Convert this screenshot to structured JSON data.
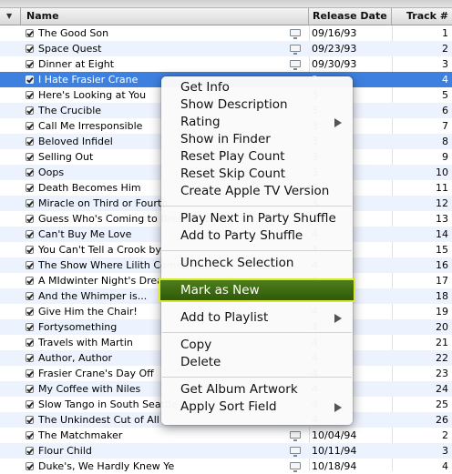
{
  "columns": {
    "name": "Name",
    "release_date": "Release Date",
    "track": "Track #"
  },
  "tracks": [
    {
      "name": "The Good Son",
      "date": "09/16/93",
      "track": "1",
      "tv": true
    },
    {
      "name": "Space Quest",
      "date": "09/23/93",
      "track": "2",
      "tv": true
    },
    {
      "name": "Dinner at Eight",
      "date": "09/30/93",
      "track": "3",
      "tv": true
    },
    {
      "name": "I Hate Frasier Crane",
      "date": "3",
      "track": "4",
      "tv": false
    },
    {
      "name": "Here's Looking at You",
      "date": "3",
      "track": "5",
      "tv": false
    },
    {
      "name": "The Crucible",
      "date": "3",
      "track": "6",
      "tv": false
    },
    {
      "name": "Call Me Irresponsible",
      "date": "3",
      "track": "7",
      "tv": false
    },
    {
      "name": "Beloved Infidel",
      "date": "3",
      "track": "8",
      "tv": false
    },
    {
      "name": "Selling Out",
      "date": "3",
      "track": "9",
      "tv": false
    },
    {
      "name": "Oops",
      "date": "3",
      "track": "10",
      "tv": false
    },
    {
      "name": "Death Becomes Him",
      "date": "3",
      "track": "11",
      "tv": false
    },
    {
      "name": "Miracle on Third or Fourth",
      "date": "3",
      "track": "12",
      "tv": false
    },
    {
      "name": "Guess Who's Coming to Breakfast",
      "date": "4",
      "track": "13",
      "tv": false
    },
    {
      "name": "Can't Buy Me Love",
      "date": "4",
      "track": "14",
      "tv": false
    },
    {
      "name": "You Can't Tell a Crook by",
      "date": "4",
      "track": "15",
      "tv": false
    },
    {
      "name": "The Show Where Lilith Comes",
      "date": "4",
      "track": "16",
      "tv": false
    },
    {
      "name": "A MIdwinter Night's Dream",
      "date": "4",
      "track": "17",
      "tv": false
    },
    {
      "name": "And the Whimper is...",
      "date": "4",
      "track": "18",
      "tv": false
    },
    {
      "name": "Give Him the Chair!",
      "date": "4",
      "track": "19",
      "tv": false
    },
    {
      "name": "Fortysomething",
      "date": "4",
      "track": "20",
      "tv": false
    },
    {
      "name": "Travels with Martin",
      "date": "4",
      "track": "21",
      "tv": false
    },
    {
      "name": "Author, Author",
      "date": "4",
      "track": "22",
      "tv": false
    },
    {
      "name": "Frasier Crane's Day Off",
      "date": "4",
      "track": "23",
      "tv": false
    },
    {
      "name": "My Coffee with Niles",
      "date": "4",
      "track": "24",
      "tv": false
    },
    {
      "name": "Slow Tango in South Seattle",
      "date": "4",
      "track": "25",
      "tv": false
    },
    {
      "name": "The Unkindest Cut of All",
      "date": "4",
      "track": "26",
      "tv": false
    },
    {
      "name": "The Matchmaker",
      "date": "10/04/94",
      "track": "2",
      "tv": true
    },
    {
      "name": "Flour Child",
      "date": "10/11/94",
      "track": "3",
      "tv": true
    },
    {
      "name": "Duke's, We Hardly Knew Ye",
      "date": "10/18/94",
      "track": "4",
      "tv": true
    }
  ],
  "context_menu": {
    "groups": [
      [
        {
          "label": "Get Info",
          "submenu": false
        },
        {
          "label": "Show Description",
          "submenu": false
        },
        {
          "label": "Rating",
          "submenu": true
        },
        {
          "label": "Show in Finder",
          "submenu": false
        },
        {
          "label": "Reset Play Count",
          "submenu": false
        },
        {
          "label": "Reset Skip Count",
          "submenu": false
        },
        {
          "label": "Create Apple TV Version",
          "submenu": false
        }
      ],
      [
        {
          "label": "Play Next in Party Shuffle",
          "submenu": false
        },
        {
          "label": "Add to Party Shuffle",
          "submenu": false
        }
      ],
      [
        {
          "label": "Uncheck Selection",
          "submenu": false
        }
      ],
      [
        {
          "label": "Mark as New",
          "submenu": false,
          "highlighted": true
        }
      ],
      [
        {
          "label": "Add to Playlist",
          "submenu": true
        }
      ],
      [
        {
          "label": "Copy",
          "submenu": false
        },
        {
          "label": "Delete",
          "submenu": false
        }
      ],
      [
        {
          "label": "Get Album Artwork",
          "submenu": false
        },
        {
          "label": "Apply Sort Field",
          "submenu": true
        }
      ]
    ]
  },
  "selected_row": 3,
  "colors": {
    "selection": "#3d80df",
    "highlight": "#3f6c12",
    "highlight_outline": "#d8e82a",
    "alt_row": "#edf3fe"
  }
}
